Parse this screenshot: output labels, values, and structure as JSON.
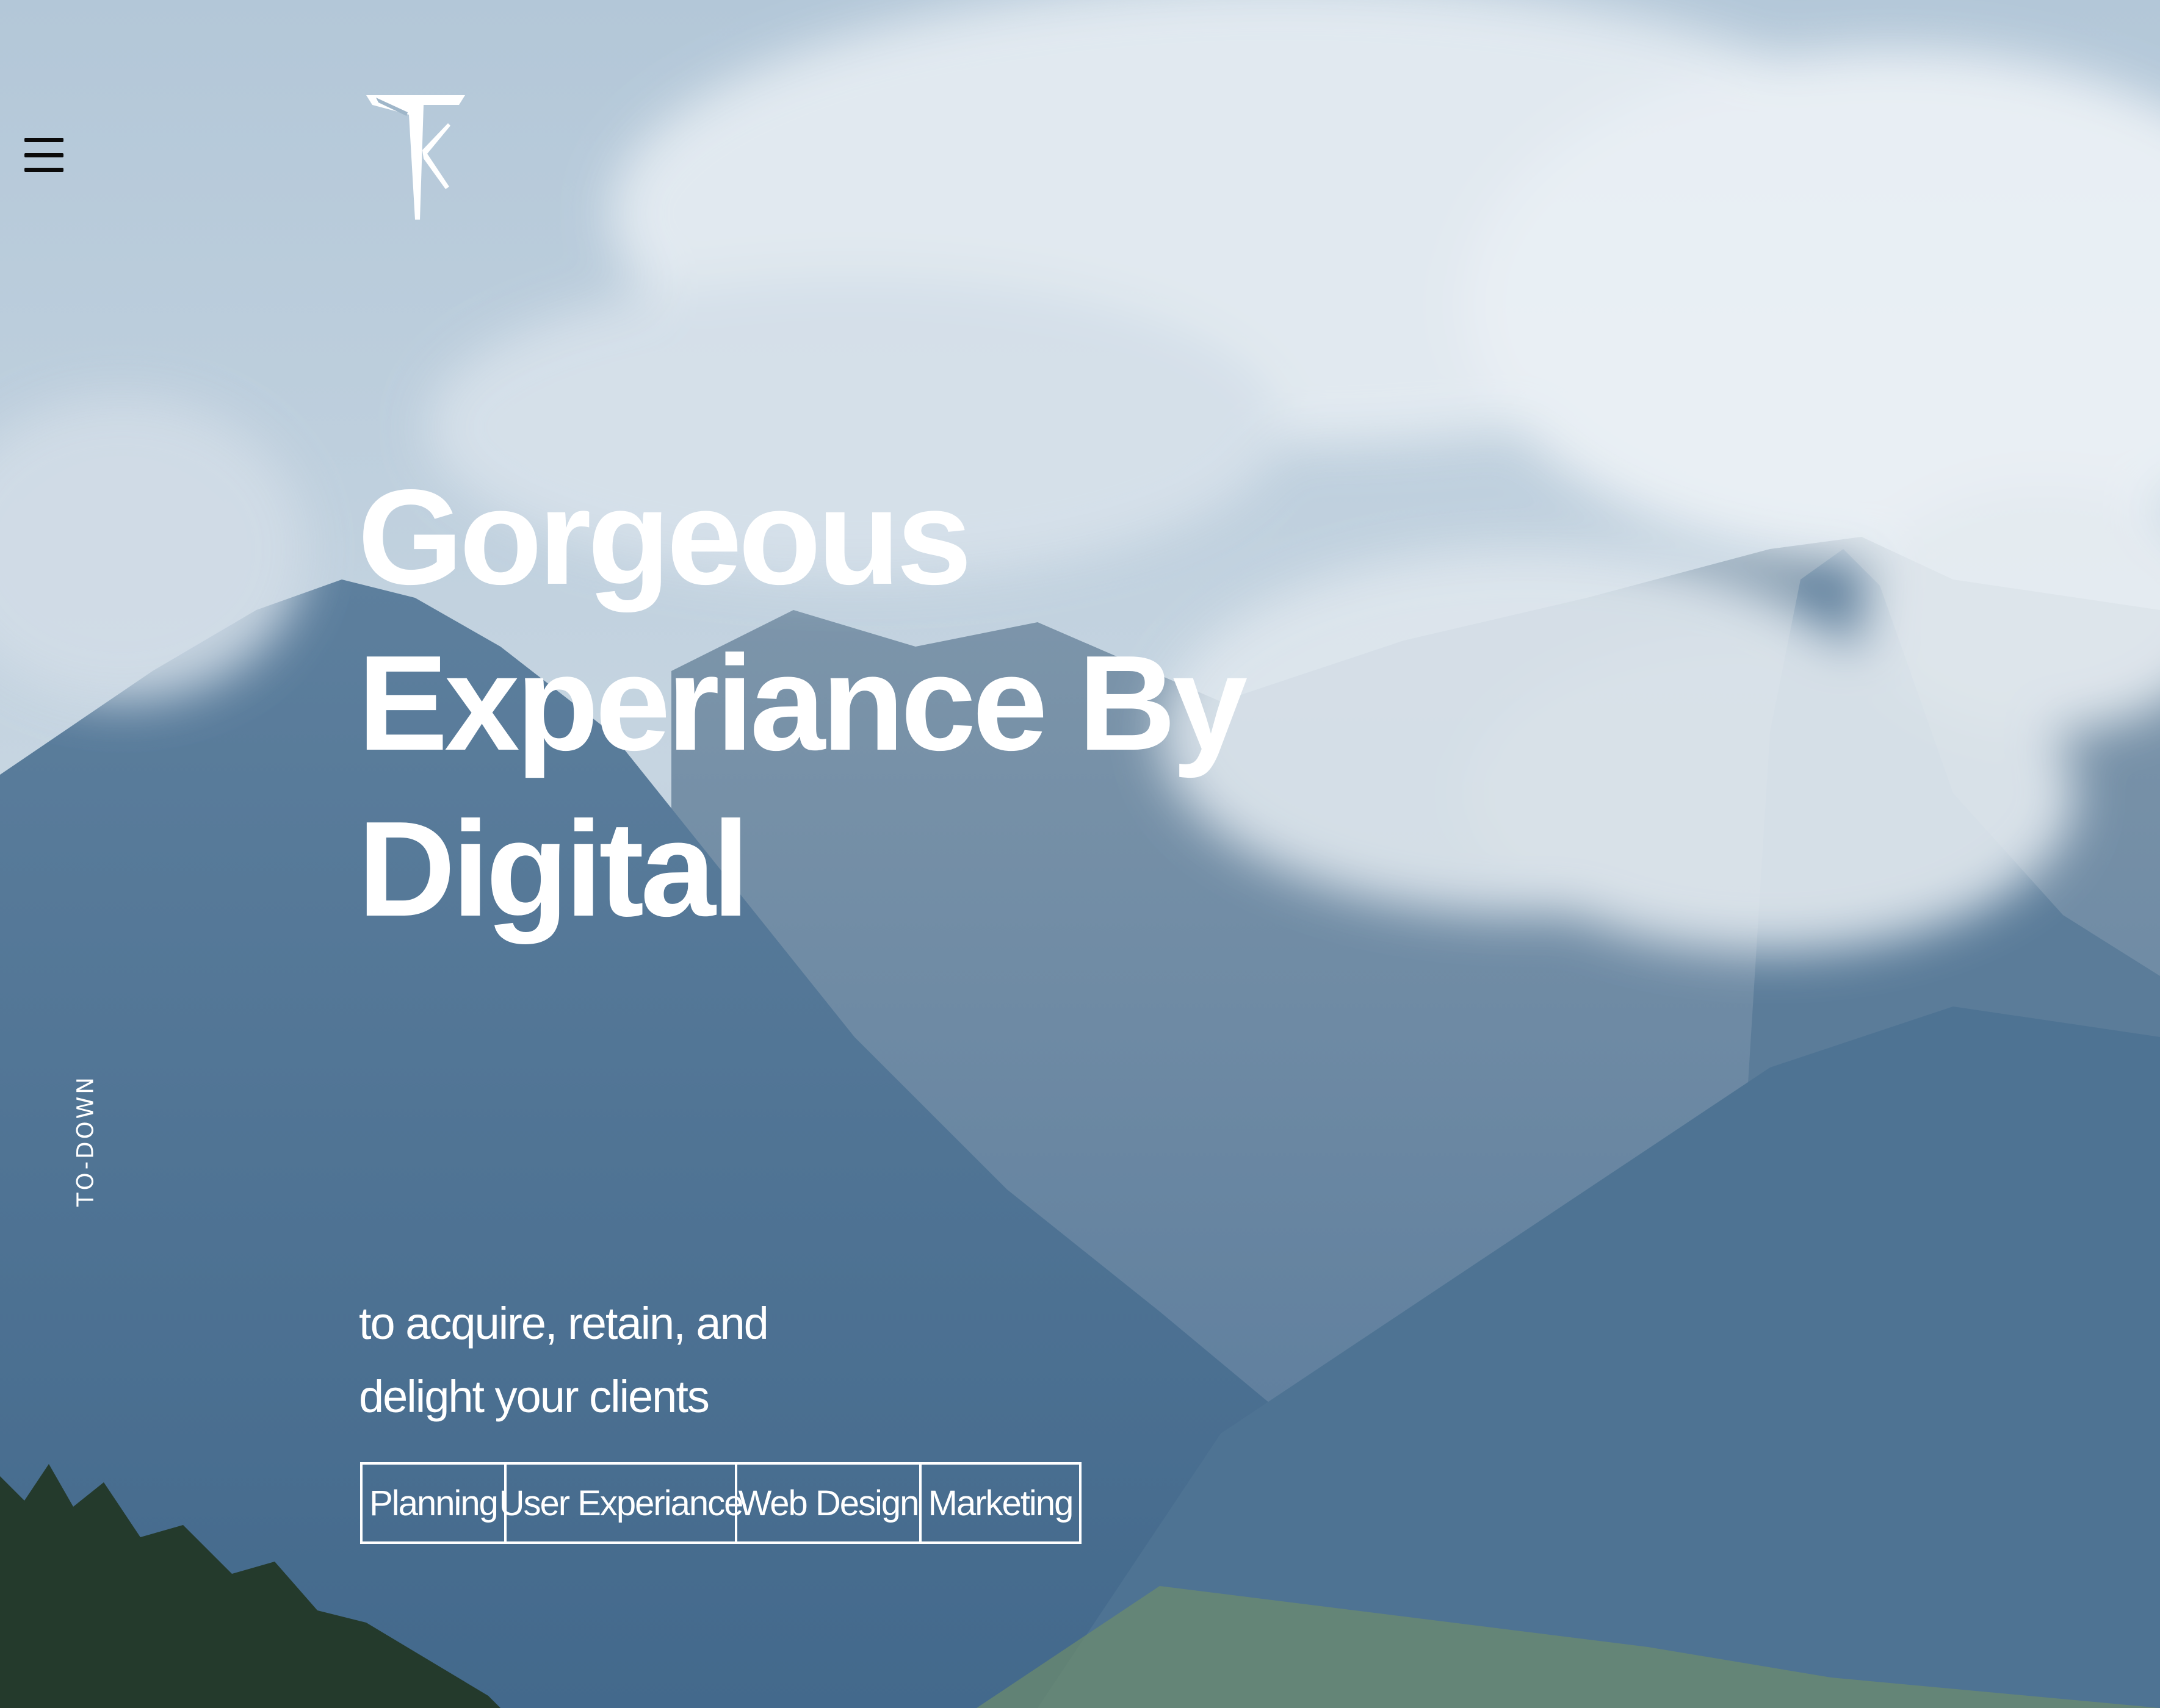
{
  "header": {
    "menu_icon": "hamburger-menu-icon",
    "logo_icon": "tk-monogram-logo"
  },
  "hero": {
    "headline_lines": [
      "Gorgeous",
      "Experiance By",
      "Digital"
    ],
    "scroll_label": "TO-DOWN",
    "subtitle_lines": [
      "to acquire, retain, and",
      "delight your clients"
    ],
    "tags": [
      "Planning",
      "User Experiance",
      "Web Design",
      "Marketing"
    ]
  },
  "colors": {
    "text": "#ffffff",
    "menu_icon": "#0b0b0b",
    "sky": "#c9d7e3",
    "mountain": "#4a6f8f"
  }
}
